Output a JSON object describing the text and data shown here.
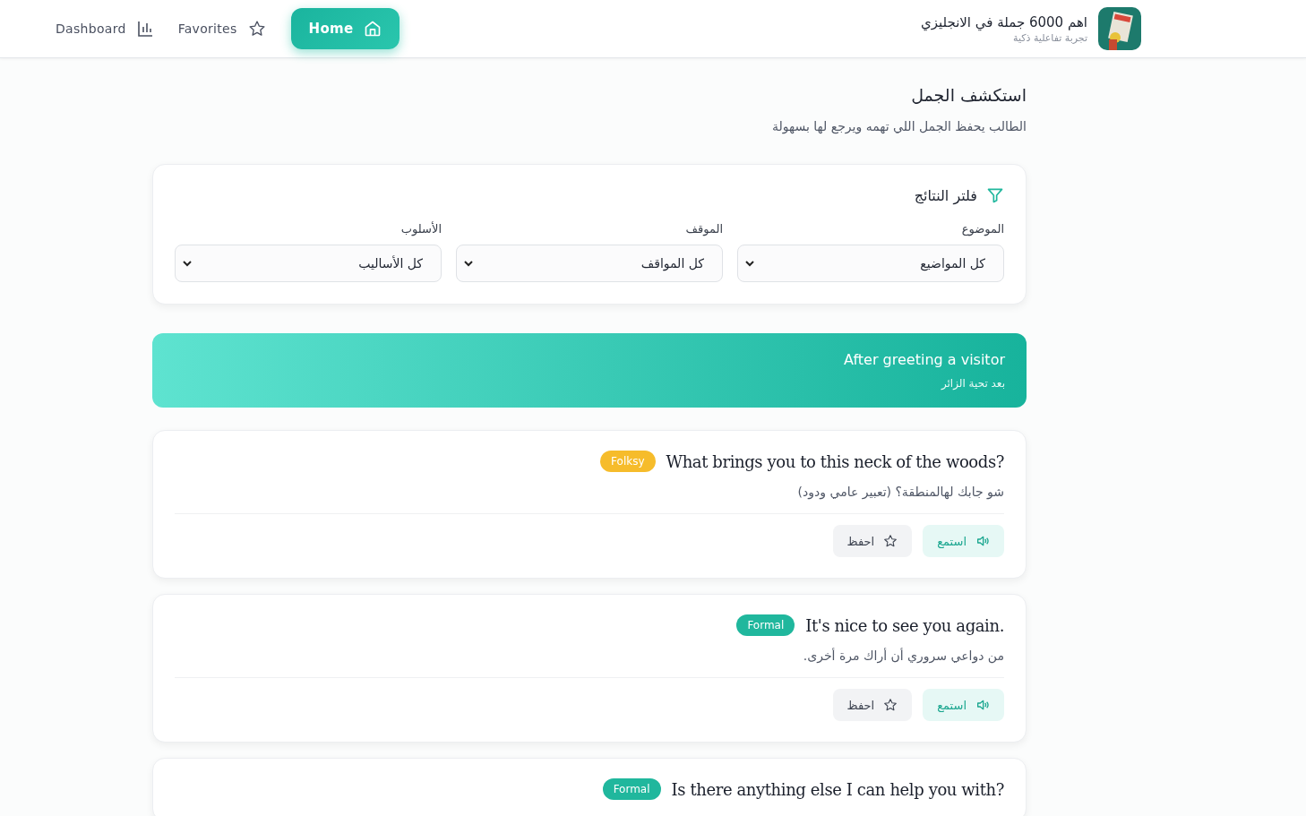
{
  "header": {
    "brand": {
      "title": "اهم 6000 جملة في الانجليزي",
      "subtitle": "تجربة تفاعلية ذكية"
    },
    "nav": [
      {
        "label": "Home",
        "selected": true
      },
      {
        "label": "Favorites",
        "selected": false
      },
      {
        "label": "Dashboard",
        "selected": false
      }
    ]
  },
  "page": {
    "title": "استكشف الجمل",
    "subtitle": "الطالب يحفظ الجمل اللي تهمه ويرجع لها بسهولة"
  },
  "filter": {
    "title": "فلتر النتائج",
    "fields": [
      {
        "label": "الموضوع",
        "value": "كل المواضيع"
      },
      {
        "label": "الموقف",
        "value": "كل المواقف"
      },
      {
        "label": "الأسلوب",
        "value": "كل الأساليب"
      }
    ]
  },
  "category": {
    "title": "After greeting a visitor",
    "subtitle": "بعد تحية الزائر"
  },
  "phrases": [
    {
      "tag": "Folksy",
      "color": "#f6bc2b",
      "english": "What brings you to this neck of the woods?",
      "arabic": "شو جابك لهالمنطقة؟ (تعبير عامي ودود)",
      "listen": "استمع",
      "save": "احفظ"
    },
    {
      "tag": "Formal",
      "color": "#20b79d",
      "english": "It's nice to see you again.",
      "arabic": "من دواعي سروري أن أراك مرة أخرى.",
      "listen": "استمع",
      "save": "احفظ"
    },
    {
      "tag": "Formal",
      "color": "#20b79d",
      "english": "Is there anything else I can help you with?"
    }
  ]
}
